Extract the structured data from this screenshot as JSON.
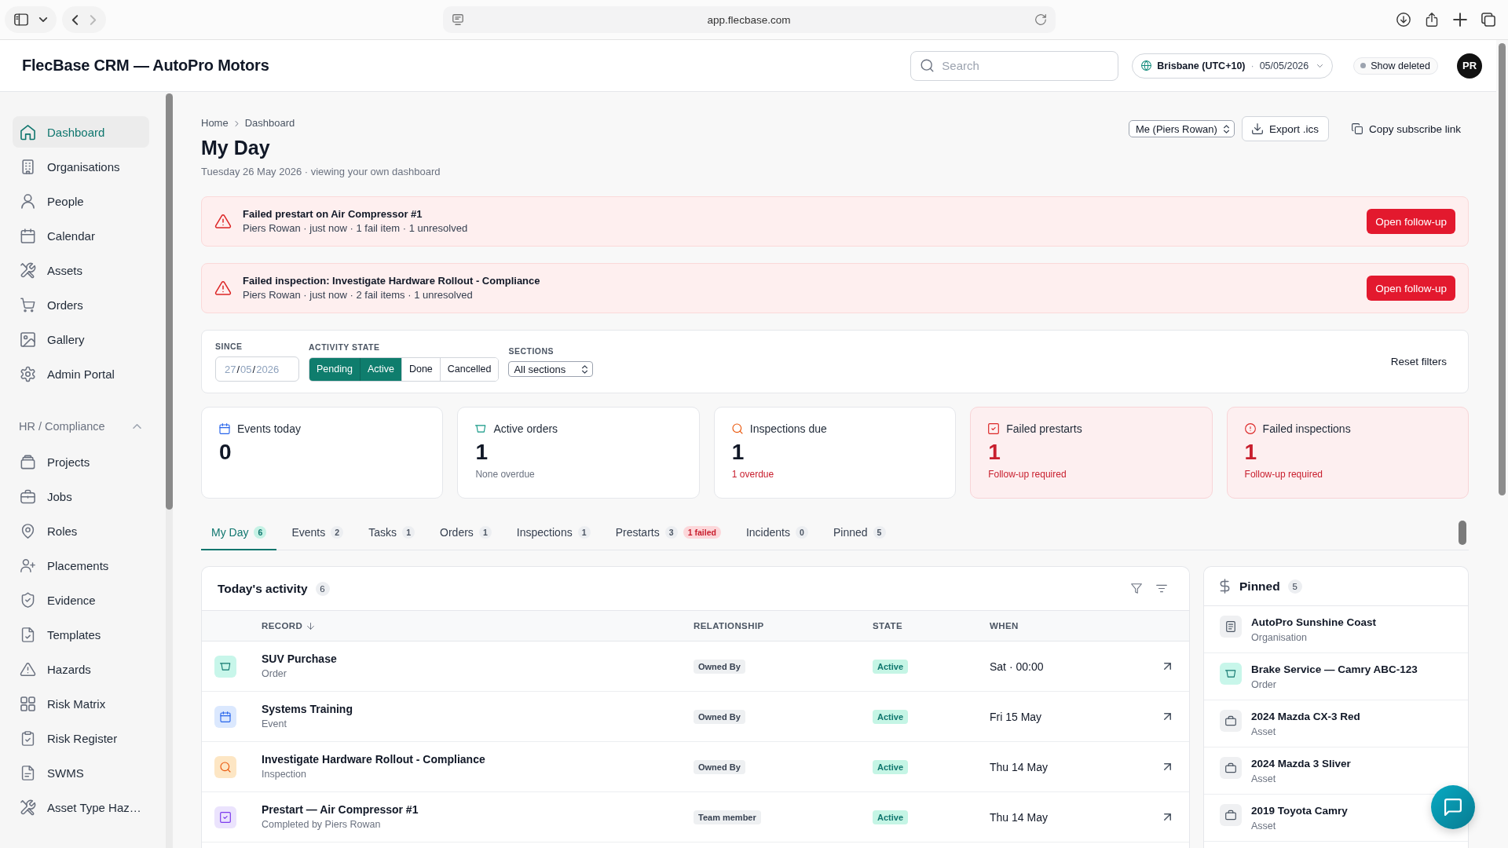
{
  "browser": {
    "url": "app.flecbase.com",
    "can_go_back": true,
    "can_go_forward": false
  },
  "header": {
    "title": "FlecBase CRM — AutoPro Motors",
    "search": {
      "placeholder": "Search"
    },
    "timezone": {
      "zone": "Brisbane (UTC+10)",
      "separator": "·",
      "date": "05/05/2026"
    },
    "show_deleted": {
      "label": "Show deleted",
      "on": false
    },
    "avatar": {
      "initials": "PR"
    }
  },
  "sidebar": {
    "items": [
      {
        "label": "Dashboard",
        "selected": true
      },
      {
        "label": "Organisations",
        "selected": false
      },
      {
        "label": "People",
        "selected": false
      },
      {
        "label": "Calendar",
        "selected": false
      },
      {
        "label": "Assets",
        "selected": false
      },
      {
        "label": "Orders",
        "selected": false
      },
      {
        "label": "Gallery",
        "selected": false
      },
      {
        "label": "Admin Portal",
        "selected": false
      }
    ],
    "section": {
      "label": "HR / Compliance",
      "expanded": true,
      "items": [
        {
          "label": "Projects",
          "selected": false
        },
        {
          "label": "Jobs",
          "selected": false
        },
        {
          "label": "Roles",
          "selected": false
        },
        {
          "label": "Placements",
          "selected": false
        },
        {
          "label": "Evidence",
          "selected": false
        },
        {
          "label": "Templates",
          "selected": false
        },
        {
          "label": "Hazards",
          "selected": false
        },
        {
          "label": "Risk Matrix",
          "selected": false
        },
        {
          "label": "Risk Register",
          "selected": false
        },
        {
          "label": "SWMS",
          "selected": false
        },
        {
          "label": "Asset Type Haz…",
          "selected": false
        }
      ]
    }
  },
  "breadcrumb": [
    {
      "label": "Home"
    },
    {
      "label": "Dashboard"
    }
  ],
  "page": {
    "title": "My Day",
    "subtitle": "Tuesday 26 May 2026 · viewing your own dashboard",
    "viewer_select": "Me (Piers Rowan)",
    "export_button": "Export .ics",
    "copy_link": "Copy subscribe link"
  },
  "alerts": [
    {
      "title": "Failed prestart on Air Compressor #1",
      "detail": "Piers Rowan · just now · 1 fail item · 1 unresolved",
      "button": "Open follow-up"
    },
    {
      "title": "Failed inspection: Investigate Hardware Rollout - Compliance",
      "detail": "Piers Rowan · just now · 2 fail items · 1 unresolved",
      "button": "Open follow-up"
    }
  ],
  "filters": {
    "since": {
      "label": "SINCE",
      "value": "27/05/2026"
    },
    "activity_state": {
      "label": "ACTIVITY STATE",
      "options": [
        {
          "label": "Pending",
          "selected": true
        },
        {
          "label": "Active",
          "selected": true
        },
        {
          "label": "Done",
          "selected": false
        },
        {
          "label": "Cancelled",
          "selected": false
        }
      ]
    },
    "sections": {
      "label": "SECTIONS",
      "value": "All sections"
    },
    "reset": "Reset filters"
  },
  "stats": [
    {
      "kind": "events",
      "label": "Events today",
      "value": "0",
      "failed": false
    },
    {
      "kind": "orders",
      "label": "Active orders",
      "value": "1",
      "note": "None overdue",
      "note_urgent": false,
      "failed": false
    },
    {
      "kind": "inspections",
      "label": "Inspections due",
      "value": "1",
      "note": "1 overdue",
      "note_urgent": true,
      "failed": false
    },
    {
      "kind": "prestart_failures",
      "label": "Failed prestarts",
      "value": "1",
      "note": "Follow-up required",
      "note_urgent": true,
      "failed": true
    },
    {
      "kind": "inspection_failures",
      "label": "Failed inspections",
      "value": "1",
      "note": "Follow-up required",
      "note_urgent": true,
      "failed": true
    }
  ],
  "tabs": [
    {
      "label": "My Day",
      "count": "6",
      "selected": true
    },
    {
      "label": "Events",
      "count": "2",
      "selected": false
    },
    {
      "label": "Tasks",
      "count": "1",
      "selected": false
    },
    {
      "label": "Orders",
      "count": "1",
      "selected": false
    },
    {
      "label": "Inspections",
      "count": "1",
      "selected": false
    },
    {
      "label": "Prestarts",
      "count": "3",
      "flag": "1 failed",
      "selected": false
    },
    {
      "label": "Incidents",
      "count": "0",
      "selected": false
    },
    {
      "label": "Pinned",
      "count": "5",
      "selected": false
    }
  ],
  "activity": {
    "title": "Today's activity",
    "count": "6",
    "columns": [
      {
        "label": "RECORD",
        "sorted": true
      },
      {
        "label": "RELATIONSHIP",
        "sorted": false
      },
      {
        "label": "STATE",
        "sorted": false
      },
      {
        "label": "WHEN",
        "sorted": false
      }
    ],
    "rows": [
      {
        "kind": "order",
        "title": "SUV Purchase",
        "type": "Order",
        "relationship": "Owned By",
        "state": "Active",
        "when": "Sat · 00:00"
      },
      {
        "kind": "event",
        "title": "Systems Training",
        "type": "Event",
        "relationship": "Owned By",
        "state": "Active",
        "when": "Fri 15 May"
      },
      {
        "kind": "inspection",
        "title": "Investigate Hardware Rollout - Compliance",
        "type": "Inspection",
        "relationship": "Owned By",
        "state": "Active",
        "when": "Thu 14 May"
      },
      {
        "kind": "prestart",
        "title": "Prestart — Air Compressor #1",
        "type": "Completed by Piers Rowan",
        "relationship": "Team member",
        "state": "Active",
        "when": "Thu 14 May"
      }
    ]
  },
  "pinned": {
    "title": "Pinned",
    "count": "5",
    "items": [
      {
        "kind": "organisation",
        "name": "AutoPro Sunshine Coast",
        "type": "Organisation"
      },
      {
        "kind": "order",
        "name": "Brake Service — Camry ABC-123",
        "type": "Order"
      },
      {
        "kind": "asset",
        "name": "2024 Mazda CX-3 Red",
        "type": "Asset"
      },
      {
        "kind": "asset",
        "name": "2024 Mazda 3 Sliver",
        "type": "Asset"
      },
      {
        "kind": "asset",
        "name": "2019 Toyota Camry",
        "type": "Asset"
      }
    ]
  }
}
